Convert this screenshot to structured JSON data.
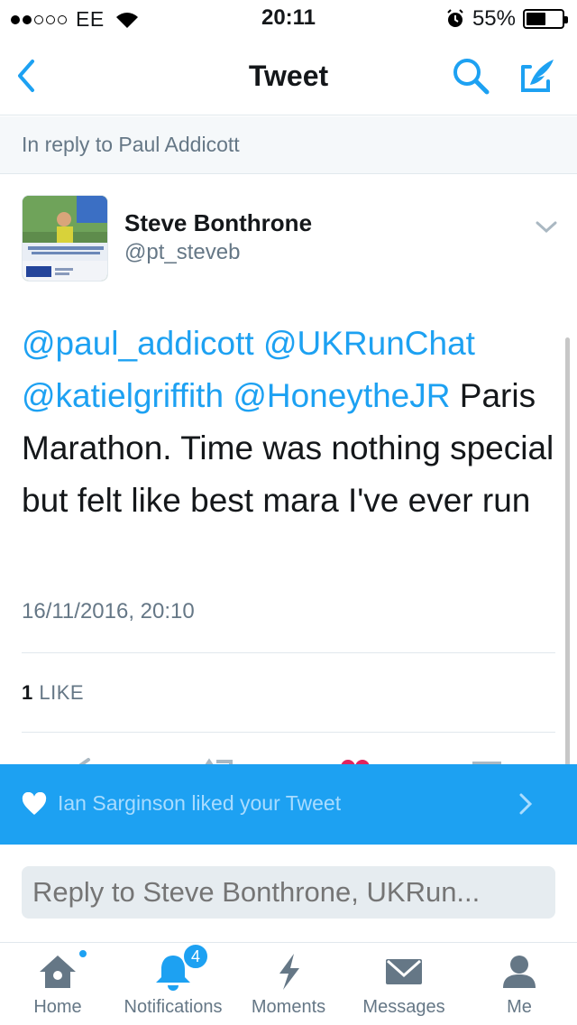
{
  "status_bar": {
    "carrier": "EE",
    "time": "20:11",
    "battery": "55%",
    "battery_level": 0.55
  },
  "nav": {
    "title": "Tweet"
  },
  "reply_banner": {
    "text": "In reply to Paul Addicott"
  },
  "tweet": {
    "author_name": "Steve Bonthrone",
    "author_handle": "@pt_steveb",
    "mentions": [
      "@paul_addicott",
      "@UKRunChat",
      "@katielgriffith",
      "@HoneytheJR"
    ],
    "body": "Paris Marathon. Time was nothing special but felt like best mara I've ever run",
    "timestamp": "16/11/2016, 20:10",
    "like_count": "1",
    "like_label": "LIKE"
  },
  "toast": {
    "text": "Ian Sarginson liked your Tweet"
  },
  "reply": {
    "placeholder": "Reply to Steve Bonthrone, UKRun..."
  },
  "tab_bar": {
    "items": [
      {
        "label": "Home",
        "icon": "home-icon"
      },
      {
        "label": "Notifications",
        "icon": "bell-icon",
        "badge": "4"
      },
      {
        "label": "Moments",
        "icon": "lightning-icon"
      },
      {
        "label": "Messages",
        "icon": "envelope-icon"
      },
      {
        "label": "Me",
        "icon": "person-icon"
      }
    ]
  },
  "colors": {
    "accent": "#1da1f2",
    "text": "#14171a",
    "secondary": "#657786",
    "banner_bg": "#f5f8fa"
  }
}
